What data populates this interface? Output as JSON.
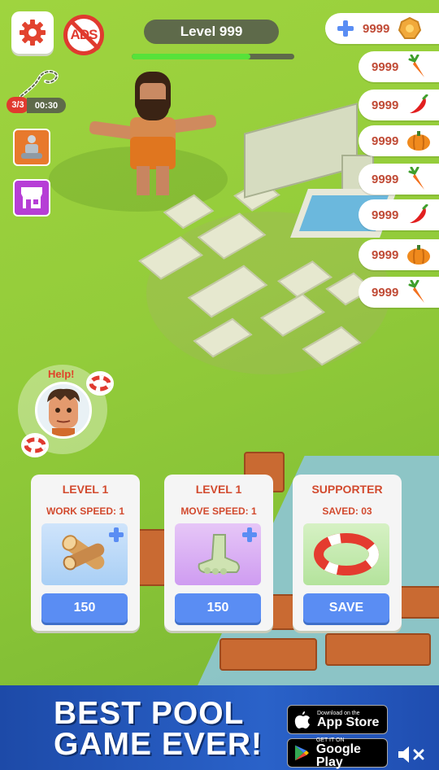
{
  "hud": {
    "level_label": "Level 999",
    "level_progress": 0.73,
    "ads_label": "ADS",
    "quest_count": "3/3",
    "quest_timer": "00:30"
  },
  "resources": [
    {
      "value": "9999",
      "icon": "gold-coin-icon"
    },
    {
      "value": "9999",
      "icon": "carrot-icon"
    },
    {
      "value": "9999",
      "icon": "chili-pepper-icon"
    },
    {
      "value": "9999",
      "icon": "pumpkin-icon"
    },
    {
      "value": "9999",
      "icon": "carrot-icon"
    },
    {
      "value": "9999",
      "icon": "chili-pepper-icon"
    },
    {
      "value": "9999",
      "icon": "pumpkin-icon"
    },
    {
      "value": "9999",
      "icon": "carrot-icon"
    }
  ],
  "help": {
    "label": "Help!"
  },
  "cards": [
    {
      "title": "LEVEL 1",
      "stat": "WORK SPEED: 1",
      "button": "150",
      "icon": "wood-logs-icon"
    },
    {
      "title": "LEVEL 1",
      "stat": "MOVE SPEED: 1",
      "button": "150",
      "icon": "foot-icon"
    },
    {
      "title": "SUPPORTER",
      "stat": "SAVED: 03",
      "button": "SAVE",
      "icon": "lifebuoy-icon"
    }
  ],
  "banner": {
    "headline_1": "BEST POOL",
    "headline_2": "GAME EVER!",
    "appstore_small": "Download on the",
    "appstore_big": "App Store",
    "googleplay_small": "GET IT ON",
    "googleplay_big": "Google Play"
  },
  "colors": {
    "accent_red": "#d24a2e",
    "button_blue": "#5a8df3",
    "progress_green": "#56e23a"
  }
}
